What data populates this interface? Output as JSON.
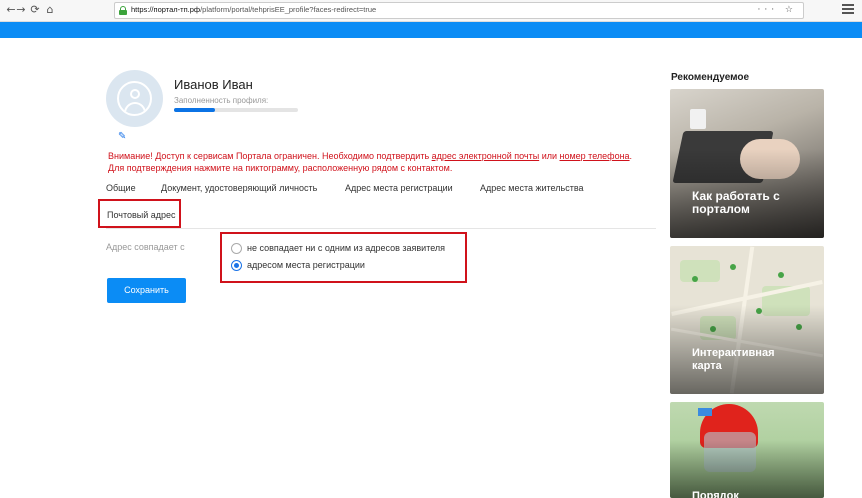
{
  "browser": {
    "back": "←",
    "forward": "→",
    "reload": "⟳",
    "home": "⌂",
    "url_host": "https://портал-тп.рф",
    "url_path": "/platform/portal/tehprisEE_profile?faces-redirect=true",
    "actions": "··· ☆"
  },
  "profile": {
    "name": "Иванов Иван",
    "progress_label": "Заполненность профиля:",
    "progress_fraction": 0.33
  },
  "warning": {
    "part1": "Внимание! Доступ к сервисам Портала ограничен. Необходимо подтвердить ",
    "link_email": "адрес электронной почты",
    "part2": " или ",
    "link_phone": "номер телефона",
    "part3": ".",
    "line2": "Для подтверждения нажмите на пиктограмму, расположенную рядом с контактом."
  },
  "tabs": [
    {
      "label": "Общие"
    },
    {
      "label": "Документ, удостоверяющий личность"
    },
    {
      "label": "Адрес места регистрации"
    },
    {
      "label": "Адрес места жительства"
    },
    {
      "label": "Почтовый адрес"
    }
  ],
  "form": {
    "address_label": "Адрес совпадает с",
    "options": [
      {
        "label": "не совпадает ни с одним из адресов заявителя",
        "checked": false
      },
      {
        "label": "адресом места регистрации",
        "checked": true
      }
    ],
    "save_label": "Сохранить"
  },
  "sidebar": {
    "title": "Рекомендуемое",
    "cards": [
      {
        "title_line1": "Как работать с",
        "title_line2": "порталом"
      },
      {
        "title_line1": "Интерактивная",
        "title_line2": "карта"
      },
      {
        "title_line1": "Порядок",
        "title_line2": ""
      }
    ]
  },
  "colors": {
    "accent": "#0b8cf5",
    "warning": "#d0121b",
    "highlight_border": "#d0121b"
  }
}
